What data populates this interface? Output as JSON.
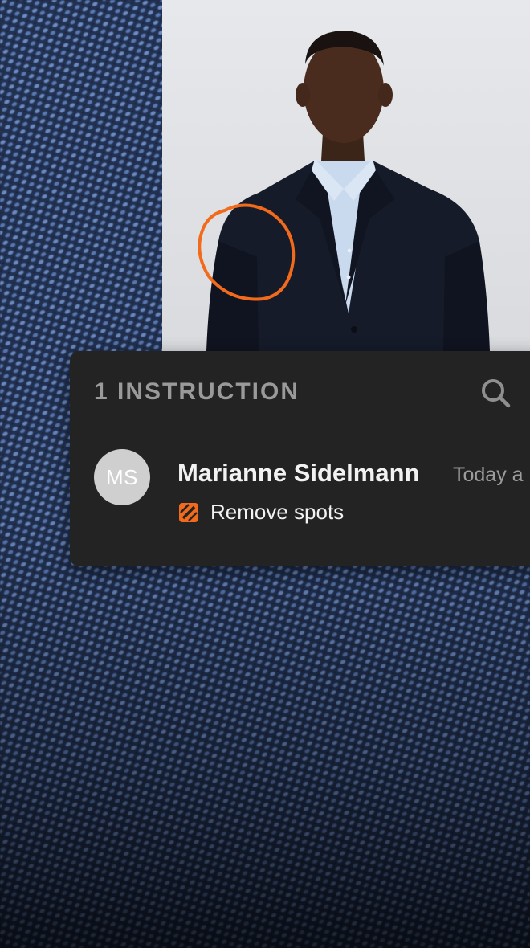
{
  "panel": {
    "title": "1 INSTRUCTION"
  },
  "icons": {
    "search": "search-icon",
    "task": "retouch-task-icon"
  },
  "instruction": {
    "author_initials": "MS",
    "author_name": "Marianne Sidelmann",
    "timestamp": "Today a",
    "task_label": "Remove spots"
  },
  "colors": {
    "annotation": "#f26a1b",
    "panel_bg": "#232323",
    "avatar_bg": "#cfcfcf"
  }
}
